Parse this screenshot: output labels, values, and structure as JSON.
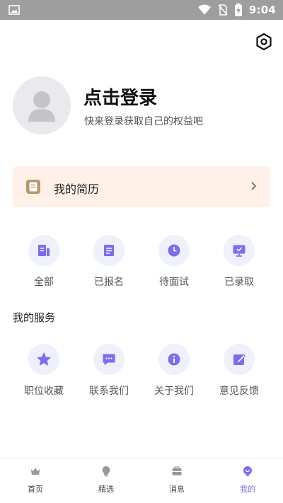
{
  "status_bar": {
    "time": "9:04",
    "icons": [
      "image-icon",
      "wifi-icon",
      "no-sim-icon",
      "battery-charging-icon"
    ]
  },
  "header": {
    "settings_icon": "gear-icon"
  },
  "profile": {
    "title": "点击登录",
    "subtitle": "快来登录获取自己的权益吧",
    "avatar_icon": "default-avatar-icon"
  },
  "resume": {
    "label": "我的简历",
    "icon": "resume-icon",
    "chevron": "chevron-right-icon"
  },
  "applications": [
    {
      "label": "全部",
      "icon": "document-icon"
    },
    {
      "label": "已报名",
      "icon": "list-icon"
    },
    {
      "label": "待面试",
      "icon": "clock-icon"
    },
    {
      "label": "已录取",
      "icon": "monitor-icon"
    }
  ],
  "services": {
    "title": "我的服务",
    "items": [
      {
        "label": "职位收藏",
        "icon": "star-icon"
      },
      {
        "label": "联系我们",
        "icon": "chat-icon"
      },
      {
        "label": "关于我们",
        "icon": "info-icon"
      },
      {
        "label": "意见反馈",
        "icon": "edit-icon"
      }
    ]
  },
  "tabbar": {
    "active": "我的",
    "tabs": [
      {
        "label": "首页",
        "icon": "crown-icon"
      },
      {
        "label": "精选",
        "icon": "bulb-icon"
      },
      {
        "label": "消息",
        "icon": "message-box-icon"
      },
      {
        "label": "我的",
        "icon": "profile-icon"
      }
    ]
  },
  "colors": {
    "accent": "#7b6cf0",
    "icon_circle_bg": "#eef0fb",
    "resume_bg": "#fff1e8",
    "statusbar_bg": "#9e9e9e"
  }
}
